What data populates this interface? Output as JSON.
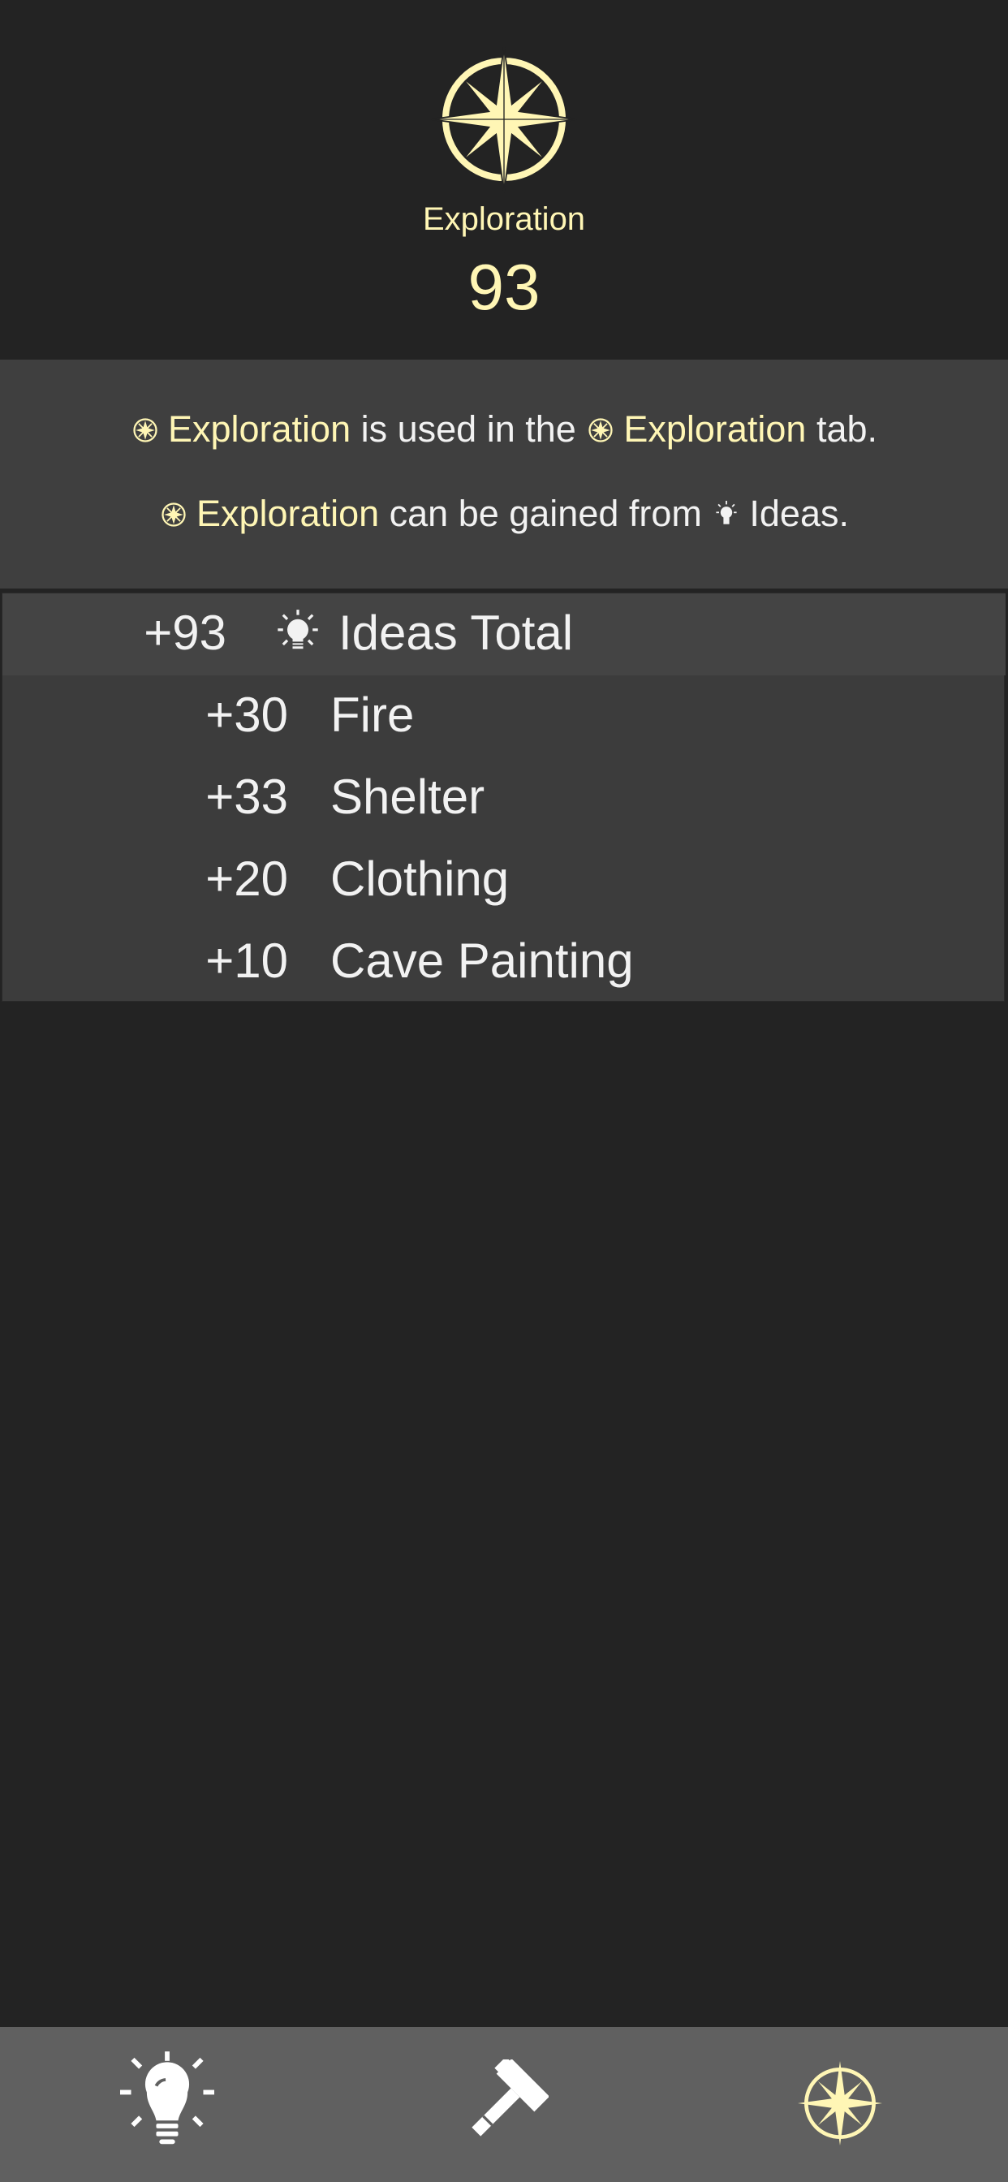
{
  "header": {
    "icon": "compass-rose-icon",
    "name": "Exploration",
    "value": "93",
    "accent_color": "#fff6b5"
  },
  "info": {
    "line1": {
      "resource": "Exploration",
      "text_before_tab": "is used in the",
      "tab_name": "Exploration",
      "text_after": "tab."
    },
    "line2": {
      "resource": "Exploration",
      "text_middle": "can be gained from",
      "source_icon": "lightbulb-icon",
      "source": "Ideas."
    }
  },
  "sources": {
    "total": {
      "amount": "+93",
      "icon": "lightbulb-icon",
      "label": "Ideas Total"
    },
    "items": [
      {
        "amount": "+30",
        "label": "Fire"
      },
      {
        "amount": "+33",
        "label": "Shelter"
      },
      {
        "amount": "+20",
        "label": "Clothing"
      },
      {
        "amount": "+10",
        "label": "Cave Painting"
      }
    ]
  },
  "tabbar": {
    "tabs": [
      {
        "icon": "lightbulb-icon",
        "active": false
      },
      {
        "icon": "hammer-icon",
        "active": false
      },
      {
        "icon": "compass-rose-icon",
        "active": true
      }
    ]
  }
}
